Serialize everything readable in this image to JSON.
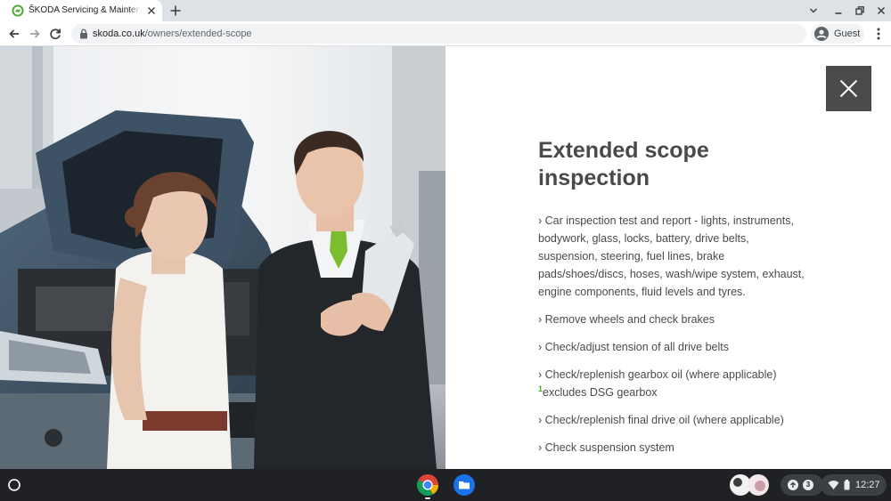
{
  "browser": {
    "tab": {
      "title": "ŠKODA Servicing & Maintenance",
      "favicon": "skoda-logo-icon"
    },
    "new_tab_icon": "plus-icon",
    "url": {
      "host": "skoda.co.uk",
      "path": "/owners/extended-scope"
    },
    "profile": {
      "label": "Guest",
      "icon": "account-circle-icon"
    },
    "window_controls": [
      "chevron-down-icon",
      "minimize-icon",
      "restore-icon",
      "close-icon"
    ]
  },
  "page": {
    "photo": {
      "subject": "photo-technician-and-customer",
      "icon": "photo"
    },
    "modal": {
      "heading": "Extended scope inspection",
      "close_icon": "close-icon",
      "items": [
        {
          "text": "› Car inspection test and report - lights, instruments, bodywork, glass, locks, battery, drive belts, suspension, steering, fuel lines, brake pads/shoes/discs, hoses, wash/wipe system, exhaust, engine components, fluid levels and tyres."
        },
        {
          "text": "› Remove wheels and check brakes"
        },
        {
          "text": "› Check/adjust tension of all drive belts"
        },
        {
          "text": "› Check/replenish gearbox oil (where applicable)",
          "note_marker": "1",
          "note": "excludes DSG gearbox"
        },
        {
          "text": "› Check/replenish final drive oil (where applicable)"
        },
        {
          "text": "› Check suspension system"
        }
      ]
    },
    "colors": {
      "heading": "#4a4a4a",
      "body_text": "#4a4a4a",
      "close_button_bg": "#4a4a4a",
      "accent_green": "#4ba82e"
    }
  },
  "shelf": {
    "launcher_icon": "launcher-circle-icon",
    "apps": [
      {
        "name": "chrome-icon"
      },
      {
        "name": "files-icon"
      }
    ],
    "notification_count": "3",
    "clock": "12:27",
    "status_icons": [
      "wifi-icon",
      "battery-icon"
    ]
  }
}
